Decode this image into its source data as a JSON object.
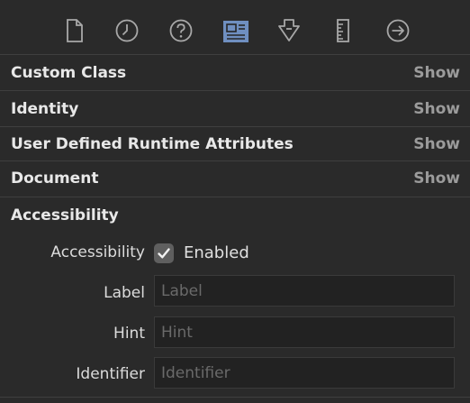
{
  "toolbar": {
    "tools": [
      {
        "icon": "file-icon",
        "selected": false
      },
      {
        "icon": "clock-icon",
        "selected": false
      },
      {
        "icon": "help-icon",
        "selected": false
      },
      {
        "icon": "identity-card-icon",
        "selected": true
      },
      {
        "icon": "attributes-arrow-icon",
        "selected": false
      },
      {
        "icon": "ruler-icon",
        "selected": false
      },
      {
        "icon": "connections-arrow-icon",
        "selected": false
      }
    ],
    "accent": "#6f8fc0"
  },
  "sections": {
    "custom_class": {
      "title": "Custom Class",
      "show": "Show"
    },
    "identity": {
      "title": "Identity",
      "show": "Show"
    },
    "runtime_attributes": {
      "title": "User Defined Runtime Attributes",
      "show": "Show"
    },
    "document": {
      "title": "Document",
      "show": "Show"
    },
    "accessibility": {
      "title": "Accessibility"
    }
  },
  "accessibility": {
    "enabled_row_label": "Accessibility",
    "enabled_checkbox_label": "Enabled",
    "enabled": true,
    "label_field": {
      "label": "Label",
      "placeholder": "Label",
      "value": ""
    },
    "hint_field": {
      "label": "Hint",
      "placeholder": "Hint",
      "value": ""
    },
    "identifier_field": {
      "label": "Identifier",
      "placeholder": "Identifier",
      "value": ""
    }
  }
}
